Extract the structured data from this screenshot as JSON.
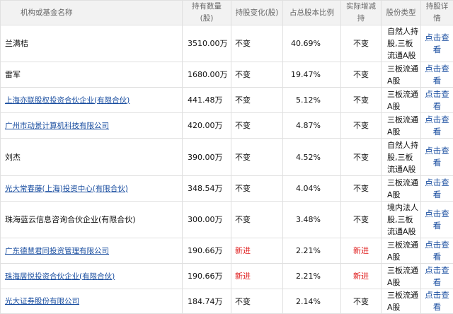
{
  "headers": {
    "name": "机构或基金名称",
    "qty": "持有数量(股)",
    "change": "持股变化(股)",
    "pct": "占总股本比例",
    "actual": "实际增减持",
    "type": "股份类型",
    "detail": "持股详情"
  },
  "rows": [
    {
      "name": "兰满桔",
      "qty": "3510.00万",
      "change": "不变",
      "pct": "40.69%",
      "actual": "不变",
      "type": "自然人持股,三板流通A股",
      "detail": "点击查看"
    },
    {
      "name": "雷军",
      "qty": "1680.00万",
      "change": "不变",
      "pct": "19.47%",
      "actual": "不变",
      "type": "三板流通A股",
      "detail": "点击查看"
    },
    {
      "name": "上海亦联股权投资合伙企业(有限合伙)",
      "qty": "441.48万",
      "change": "不变",
      "pct": "5.12%",
      "actual": "不变",
      "type": "三板流通A股",
      "detail": "点击查看"
    },
    {
      "name": "广州市动景计算机科技有限公司",
      "qty": "420.00万",
      "change": "不变",
      "pct": "4.87%",
      "actual": "不变",
      "type": "三板流通A股",
      "detail": "点击查看"
    },
    {
      "name": "刘杰",
      "qty": "390.00万",
      "change": "不变",
      "pct": "4.52%",
      "actual": "不变",
      "type": "自然人持股,三板流通A股",
      "detail": "点击查看"
    },
    {
      "name": "光大常春藤(上海)投资中心(有限合伙)",
      "qty": "348.54万",
      "change": "不变",
      "pct": "4.04%",
      "actual": "不变",
      "type": "三板流通A股",
      "detail": "点击查看"
    },
    {
      "name": "珠海蓝云信息咨询合伙企业(有限合伙)",
      "qty": "300.00万",
      "change": "不变",
      "pct": "3.48%",
      "actual": "不变",
      "type": "境内法人股,三板流通A股",
      "detail": "点击查看"
    },
    {
      "name": "广东德慧君同投资管理有限公司",
      "qty": "190.66万",
      "change": "新进",
      "pct": "2.21%",
      "actual": "新进",
      "type": "三板流通A股",
      "detail": "点击查看"
    },
    {
      "name": "珠海居悦投资合伙企业(有限合伙)",
      "qty": "190.66万",
      "change": "新进",
      "pct": "2.21%",
      "actual": "新进",
      "type": "三板流通A股",
      "detail": "点击查看"
    },
    {
      "name": "光大证券股份有限公司",
      "qty": "184.74万",
      "change": "不变",
      "pct": "2.14%",
      "actual": "不变",
      "type": "三板流通A股",
      "detail": "点击查看"
    }
  ]
}
